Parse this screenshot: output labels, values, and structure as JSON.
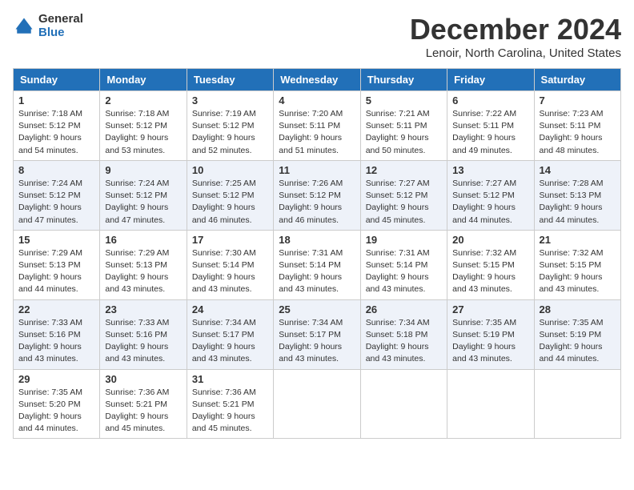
{
  "logo": {
    "general": "General",
    "blue": "Blue"
  },
  "header": {
    "title": "December 2024",
    "subtitle": "Lenoir, North Carolina, United States"
  },
  "weekdays": [
    "Sunday",
    "Monday",
    "Tuesday",
    "Wednesday",
    "Thursday",
    "Friday",
    "Saturday"
  ],
  "weeks": [
    [
      {
        "day": "1",
        "info": "Sunrise: 7:18 AM\nSunset: 5:12 PM\nDaylight: 9 hours\nand 54 minutes."
      },
      {
        "day": "2",
        "info": "Sunrise: 7:18 AM\nSunset: 5:12 PM\nDaylight: 9 hours\nand 53 minutes."
      },
      {
        "day": "3",
        "info": "Sunrise: 7:19 AM\nSunset: 5:12 PM\nDaylight: 9 hours\nand 52 minutes."
      },
      {
        "day": "4",
        "info": "Sunrise: 7:20 AM\nSunset: 5:11 PM\nDaylight: 9 hours\nand 51 minutes."
      },
      {
        "day": "5",
        "info": "Sunrise: 7:21 AM\nSunset: 5:11 PM\nDaylight: 9 hours\nand 50 minutes."
      },
      {
        "day": "6",
        "info": "Sunrise: 7:22 AM\nSunset: 5:11 PM\nDaylight: 9 hours\nand 49 minutes."
      },
      {
        "day": "7",
        "info": "Sunrise: 7:23 AM\nSunset: 5:11 PM\nDaylight: 9 hours\nand 48 minutes."
      }
    ],
    [
      {
        "day": "8",
        "info": "Sunrise: 7:24 AM\nSunset: 5:12 PM\nDaylight: 9 hours\nand 47 minutes."
      },
      {
        "day": "9",
        "info": "Sunrise: 7:24 AM\nSunset: 5:12 PM\nDaylight: 9 hours\nand 47 minutes."
      },
      {
        "day": "10",
        "info": "Sunrise: 7:25 AM\nSunset: 5:12 PM\nDaylight: 9 hours\nand 46 minutes."
      },
      {
        "day": "11",
        "info": "Sunrise: 7:26 AM\nSunset: 5:12 PM\nDaylight: 9 hours\nand 46 minutes."
      },
      {
        "day": "12",
        "info": "Sunrise: 7:27 AM\nSunset: 5:12 PM\nDaylight: 9 hours\nand 45 minutes."
      },
      {
        "day": "13",
        "info": "Sunrise: 7:27 AM\nSunset: 5:12 PM\nDaylight: 9 hours\nand 44 minutes."
      },
      {
        "day": "14",
        "info": "Sunrise: 7:28 AM\nSunset: 5:13 PM\nDaylight: 9 hours\nand 44 minutes."
      }
    ],
    [
      {
        "day": "15",
        "info": "Sunrise: 7:29 AM\nSunset: 5:13 PM\nDaylight: 9 hours\nand 44 minutes."
      },
      {
        "day": "16",
        "info": "Sunrise: 7:29 AM\nSunset: 5:13 PM\nDaylight: 9 hours\nand 43 minutes."
      },
      {
        "day": "17",
        "info": "Sunrise: 7:30 AM\nSunset: 5:14 PM\nDaylight: 9 hours\nand 43 minutes."
      },
      {
        "day": "18",
        "info": "Sunrise: 7:31 AM\nSunset: 5:14 PM\nDaylight: 9 hours\nand 43 minutes."
      },
      {
        "day": "19",
        "info": "Sunrise: 7:31 AM\nSunset: 5:14 PM\nDaylight: 9 hours\nand 43 minutes."
      },
      {
        "day": "20",
        "info": "Sunrise: 7:32 AM\nSunset: 5:15 PM\nDaylight: 9 hours\nand 43 minutes."
      },
      {
        "day": "21",
        "info": "Sunrise: 7:32 AM\nSunset: 5:15 PM\nDaylight: 9 hours\nand 43 minutes."
      }
    ],
    [
      {
        "day": "22",
        "info": "Sunrise: 7:33 AM\nSunset: 5:16 PM\nDaylight: 9 hours\nand 43 minutes."
      },
      {
        "day": "23",
        "info": "Sunrise: 7:33 AM\nSunset: 5:16 PM\nDaylight: 9 hours\nand 43 minutes."
      },
      {
        "day": "24",
        "info": "Sunrise: 7:34 AM\nSunset: 5:17 PM\nDaylight: 9 hours\nand 43 minutes."
      },
      {
        "day": "25",
        "info": "Sunrise: 7:34 AM\nSunset: 5:17 PM\nDaylight: 9 hours\nand 43 minutes."
      },
      {
        "day": "26",
        "info": "Sunrise: 7:34 AM\nSunset: 5:18 PM\nDaylight: 9 hours\nand 43 minutes."
      },
      {
        "day": "27",
        "info": "Sunrise: 7:35 AM\nSunset: 5:19 PM\nDaylight: 9 hours\nand 43 minutes."
      },
      {
        "day": "28",
        "info": "Sunrise: 7:35 AM\nSunset: 5:19 PM\nDaylight: 9 hours\nand 44 minutes."
      }
    ],
    [
      {
        "day": "29",
        "info": "Sunrise: 7:35 AM\nSunset: 5:20 PM\nDaylight: 9 hours\nand 44 minutes."
      },
      {
        "day": "30",
        "info": "Sunrise: 7:36 AM\nSunset: 5:21 PM\nDaylight: 9 hours\nand 45 minutes."
      },
      {
        "day": "31",
        "info": "Sunrise: 7:36 AM\nSunset: 5:21 PM\nDaylight: 9 hours\nand 45 minutes."
      },
      null,
      null,
      null,
      null
    ]
  ]
}
